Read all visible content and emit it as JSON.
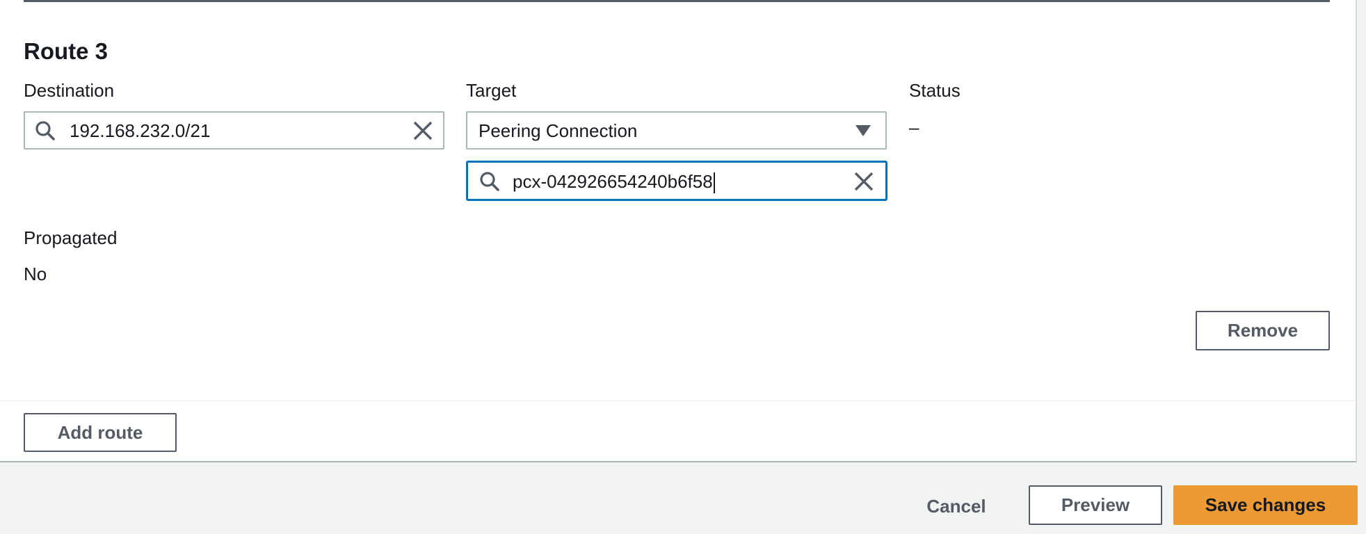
{
  "route": {
    "title": "Route 3",
    "destination": {
      "label": "Destination",
      "value": "192.168.232.0/21"
    },
    "target": {
      "label": "Target",
      "selected": "Peering Connection",
      "search_value": "pcx-042926654240b6f58"
    },
    "status": {
      "label": "Status",
      "value": "–"
    },
    "propagated": {
      "label": "Propagated",
      "value": "No"
    },
    "remove_label": "Remove"
  },
  "add_route_label": "Add route",
  "footer": {
    "cancel_label": "Cancel",
    "preview_label": "Preview",
    "save_label": "Save changes"
  },
  "colors": {
    "accent": "#ec9a34",
    "focus": "#0073bb",
    "border": "#aab7b8",
    "button_text": "#545b64"
  },
  "icons": [
    "search-icon",
    "clear-icon",
    "caret-down-icon"
  ]
}
